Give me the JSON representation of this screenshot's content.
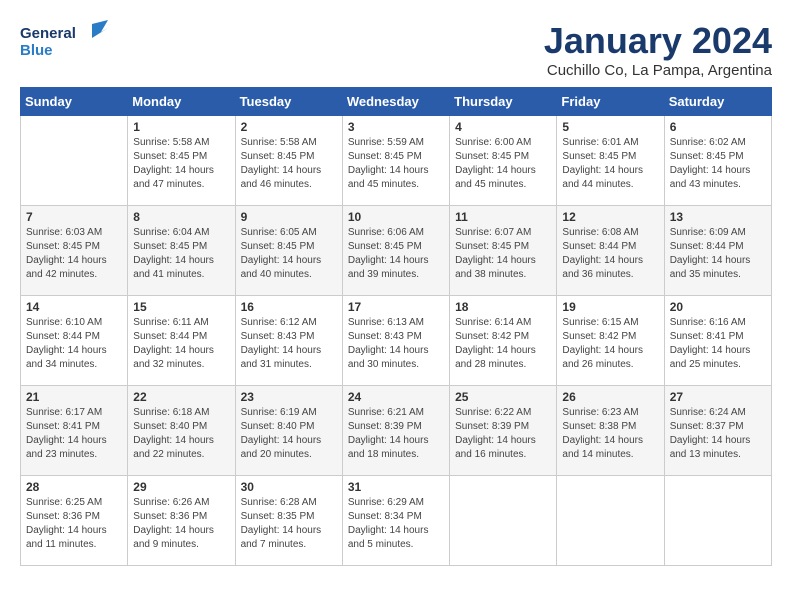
{
  "logo": {
    "line1": "General",
    "line2": "Blue"
  },
  "title": "January 2024",
  "subtitle": "Cuchillo Co, La Pampa, Argentina",
  "days_of_week": [
    "Sunday",
    "Monday",
    "Tuesday",
    "Wednesday",
    "Thursday",
    "Friday",
    "Saturday"
  ],
  "weeks": [
    [
      {
        "day": "",
        "info": ""
      },
      {
        "day": "1",
        "info": "Sunrise: 5:58 AM\nSunset: 8:45 PM\nDaylight: 14 hours\nand 47 minutes."
      },
      {
        "day": "2",
        "info": "Sunrise: 5:58 AM\nSunset: 8:45 PM\nDaylight: 14 hours\nand 46 minutes."
      },
      {
        "day": "3",
        "info": "Sunrise: 5:59 AM\nSunset: 8:45 PM\nDaylight: 14 hours\nand 45 minutes."
      },
      {
        "day": "4",
        "info": "Sunrise: 6:00 AM\nSunset: 8:45 PM\nDaylight: 14 hours\nand 45 minutes."
      },
      {
        "day": "5",
        "info": "Sunrise: 6:01 AM\nSunset: 8:45 PM\nDaylight: 14 hours\nand 44 minutes."
      },
      {
        "day": "6",
        "info": "Sunrise: 6:02 AM\nSunset: 8:45 PM\nDaylight: 14 hours\nand 43 minutes."
      }
    ],
    [
      {
        "day": "7",
        "info": "Sunrise: 6:03 AM\nSunset: 8:45 PM\nDaylight: 14 hours\nand 42 minutes."
      },
      {
        "day": "8",
        "info": "Sunrise: 6:04 AM\nSunset: 8:45 PM\nDaylight: 14 hours\nand 41 minutes."
      },
      {
        "day": "9",
        "info": "Sunrise: 6:05 AM\nSunset: 8:45 PM\nDaylight: 14 hours\nand 40 minutes."
      },
      {
        "day": "10",
        "info": "Sunrise: 6:06 AM\nSunset: 8:45 PM\nDaylight: 14 hours\nand 39 minutes."
      },
      {
        "day": "11",
        "info": "Sunrise: 6:07 AM\nSunset: 8:45 PM\nDaylight: 14 hours\nand 38 minutes."
      },
      {
        "day": "12",
        "info": "Sunrise: 6:08 AM\nSunset: 8:44 PM\nDaylight: 14 hours\nand 36 minutes."
      },
      {
        "day": "13",
        "info": "Sunrise: 6:09 AM\nSunset: 8:44 PM\nDaylight: 14 hours\nand 35 minutes."
      }
    ],
    [
      {
        "day": "14",
        "info": "Sunrise: 6:10 AM\nSunset: 8:44 PM\nDaylight: 14 hours\nand 34 minutes."
      },
      {
        "day": "15",
        "info": "Sunrise: 6:11 AM\nSunset: 8:44 PM\nDaylight: 14 hours\nand 32 minutes."
      },
      {
        "day": "16",
        "info": "Sunrise: 6:12 AM\nSunset: 8:43 PM\nDaylight: 14 hours\nand 31 minutes."
      },
      {
        "day": "17",
        "info": "Sunrise: 6:13 AM\nSunset: 8:43 PM\nDaylight: 14 hours\nand 30 minutes."
      },
      {
        "day": "18",
        "info": "Sunrise: 6:14 AM\nSunset: 8:42 PM\nDaylight: 14 hours\nand 28 minutes."
      },
      {
        "day": "19",
        "info": "Sunrise: 6:15 AM\nSunset: 8:42 PM\nDaylight: 14 hours\nand 26 minutes."
      },
      {
        "day": "20",
        "info": "Sunrise: 6:16 AM\nSunset: 8:41 PM\nDaylight: 14 hours\nand 25 minutes."
      }
    ],
    [
      {
        "day": "21",
        "info": "Sunrise: 6:17 AM\nSunset: 8:41 PM\nDaylight: 14 hours\nand 23 minutes."
      },
      {
        "day": "22",
        "info": "Sunrise: 6:18 AM\nSunset: 8:40 PM\nDaylight: 14 hours\nand 22 minutes."
      },
      {
        "day": "23",
        "info": "Sunrise: 6:19 AM\nSunset: 8:40 PM\nDaylight: 14 hours\nand 20 minutes."
      },
      {
        "day": "24",
        "info": "Sunrise: 6:21 AM\nSunset: 8:39 PM\nDaylight: 14 hours\nand 18 minutes."
      },
      {
        "day": "25",
        "info": "Sunrise: 6:22 AM\nSunset: 8:39 PM\nDaylight: 14 hours\nand 16 minutes."
      },
      {
        "day": "26",
        "info": "Sunrise: 6:23 AM\nSunset: 8:38 PM\nDaylight: 14 hours\nand 14 minutes."
      },
      {
        "day": "27",
        "info": "Sunrise: 6:24 AM\nSunset: 8:37 PM\nDaylight: 14 hours\nand 13 minutes."
      }
    ],
    [
      {
        "day": "28",
        "info": "Sunrise: 6:25 AM\nSunset: 8:36 PM\nDaylight: 14 hours\nand 11 minutes."
      },
      {
        "day": "29",
        "info": "Sunrise: 6:26 AM\nSunset: 8:36 PM\nDaylight: 14 hours\nand 9 minutes."
      },
      {
        "day": "30",
        "info": "Sunrise: 6:28 AM\nSunset: 8:35 PM\nDaylight: 14 hours\nand 7 minutes."
      },
      {
        "day": "31",
        "info": "Sunrise: 6:29 AM\nSunset: 8:34 PM\nDaylight: 14 hours\nand 5 minutes."
      },
      {
        "day": "",
        "info": ""
      },
      {
        "day": "",
        "info": ""
      },
      {
        "day": "",
        "info": ""
      }
    ]
  ]
}
